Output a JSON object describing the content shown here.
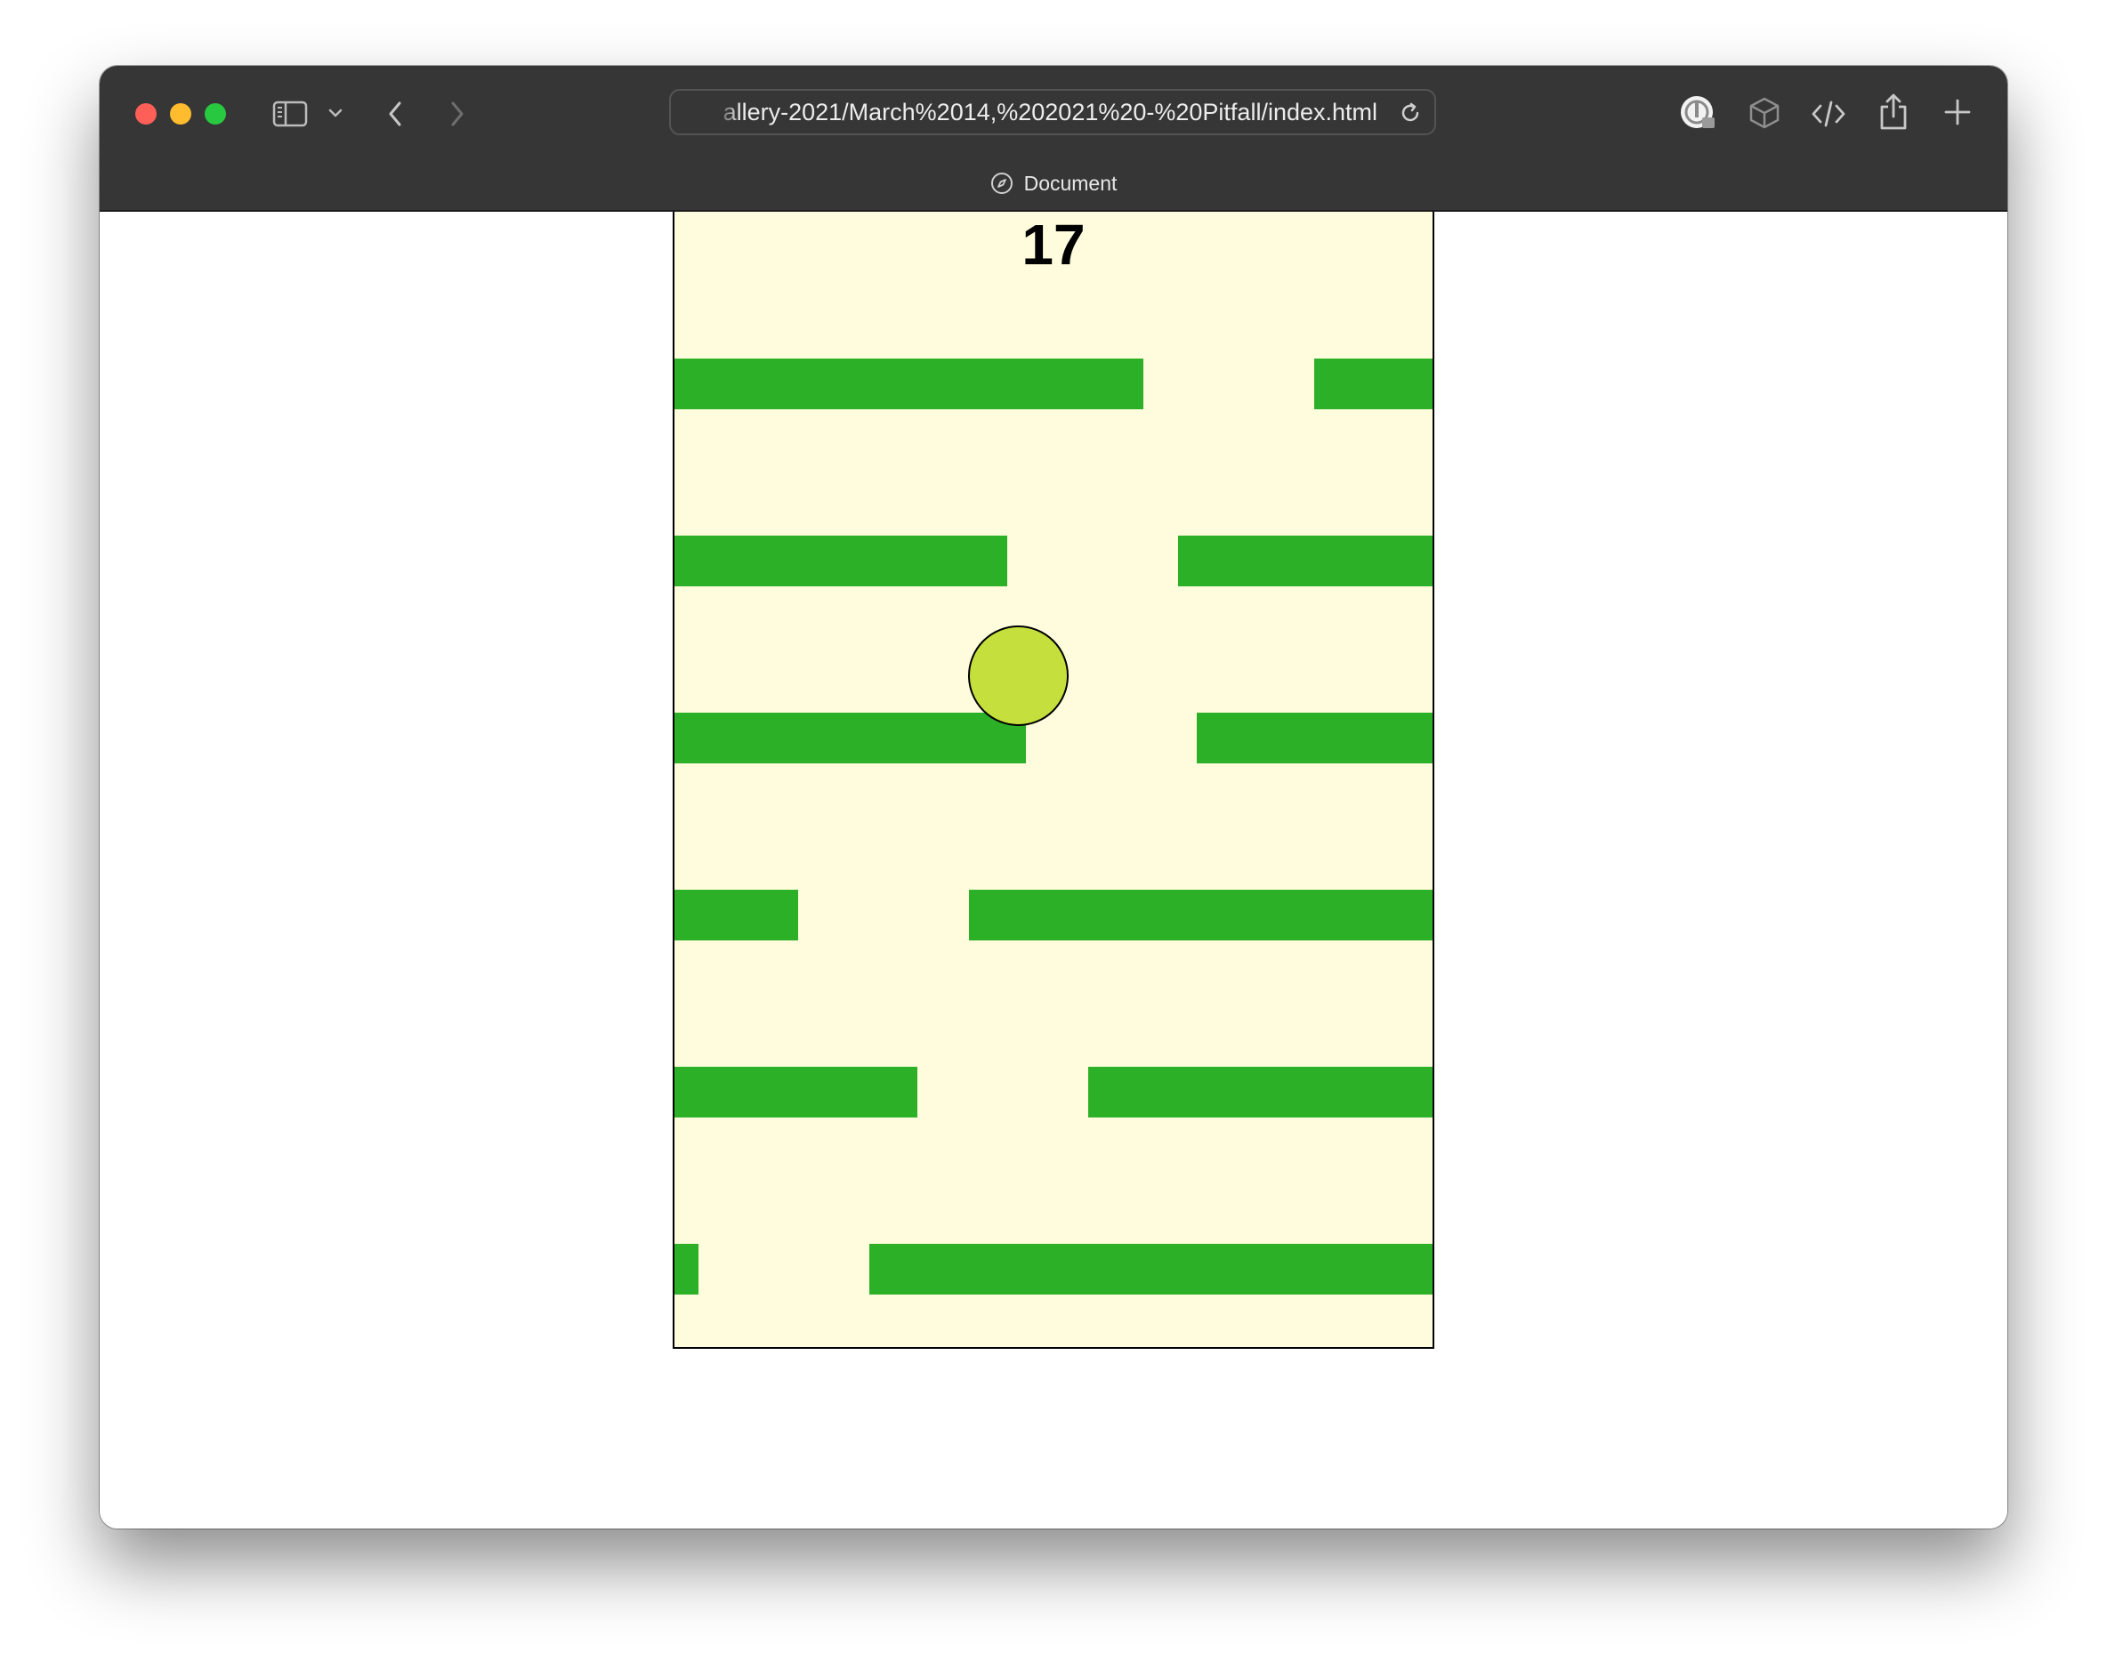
{
  "browser": {
    "url": "allery-2021/March%2014,%202021%20-%20Pitfall/index.html",
    "tab_title": "Document",
    "icons": {
      "sidebar": "sidebar-icon",
      "sidebar_menu": "chevron-down-icon",
      "back": "chevron-left-icon",
      "forward": "chevron-right-icon",
      "reload": "reload-icon",
      "extension": "extension-icon",
      "ar": "cube-icon",
      "dev": "code-icon",
      "share": "share-icon",
      "new_tab": "plus-icon",
      "tab": "compass-icon"
    }
  },
  "game": {
    "score": "17",
    "colors": {
      "background": "#fefcdc",
      "platform": "#2cb027",
      "ball": "#c5e03c"
    }
  }
}
